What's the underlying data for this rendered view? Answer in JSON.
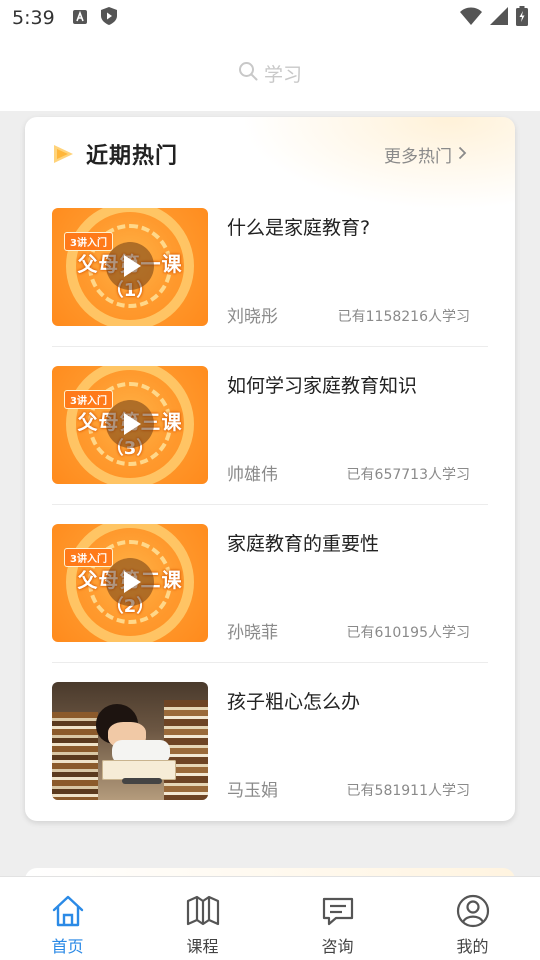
{
  "status_bar": {
    "time": "5:39",
    "left_icons": [
      "a-badge-icon",
      "shield-icon"
    ],
    "right_icons": [
      "wifi-icon",
      "signal-icon",
      "battery-icon"
    ]
  },
  "search": {
    "placeholder": "学习"
  },
  "hot_section": {
    "title": "近期热门",
    "more_label": "更多热门",
    "courses": [
      {
        "title": "什么是家庭教育?",
        "teacher": "刘晓彤",
        "learners": "已有1158216人学习",
        "thumb_tag": "3讲入门",
        "thumb_title": "父母第一课",
        "thumb_sub": "（1）"
      },
      {
        "title": "如何学习家庭教育知识",
        "teacher": "帅雄伟",
        "learners": "已有657713人学习",
        "thumb_tag": "3讲入门",
        "thumb_title": "父母第三课",
        "thumb_sub": "（3）"
      },
      {
        "title": "家庭教育的重要性",
        "teacher": "孙晓菲",
        "learners": "已有610195人学习",
        "thumb_tag": "3讲入门",
        "thumb_title": "父母第二课",
        "thumb_sub": "（2）"
      },
      {
        "title": "孩子粗心怎么办",
        "teacher": "马玉娟",
        "learners": "已有581911人学习"
      }
    ]
  },
  "tab_bar": {
    "active_color": "#2b8ae6",
    "items": [
      {
        "label": "首页",
        "icon": "home-icon",
        "active": true
      },
      {
        "label": "课程",
        "icon": "book-icon",
        "active": false
      },
      {
        "label": "咨询",
        "icon": "chat-icon",
        "active": false
      },
      {
        "label": "我的",
        "icon": "user-icon",
        "active": false
      }
    ]
  }
}
